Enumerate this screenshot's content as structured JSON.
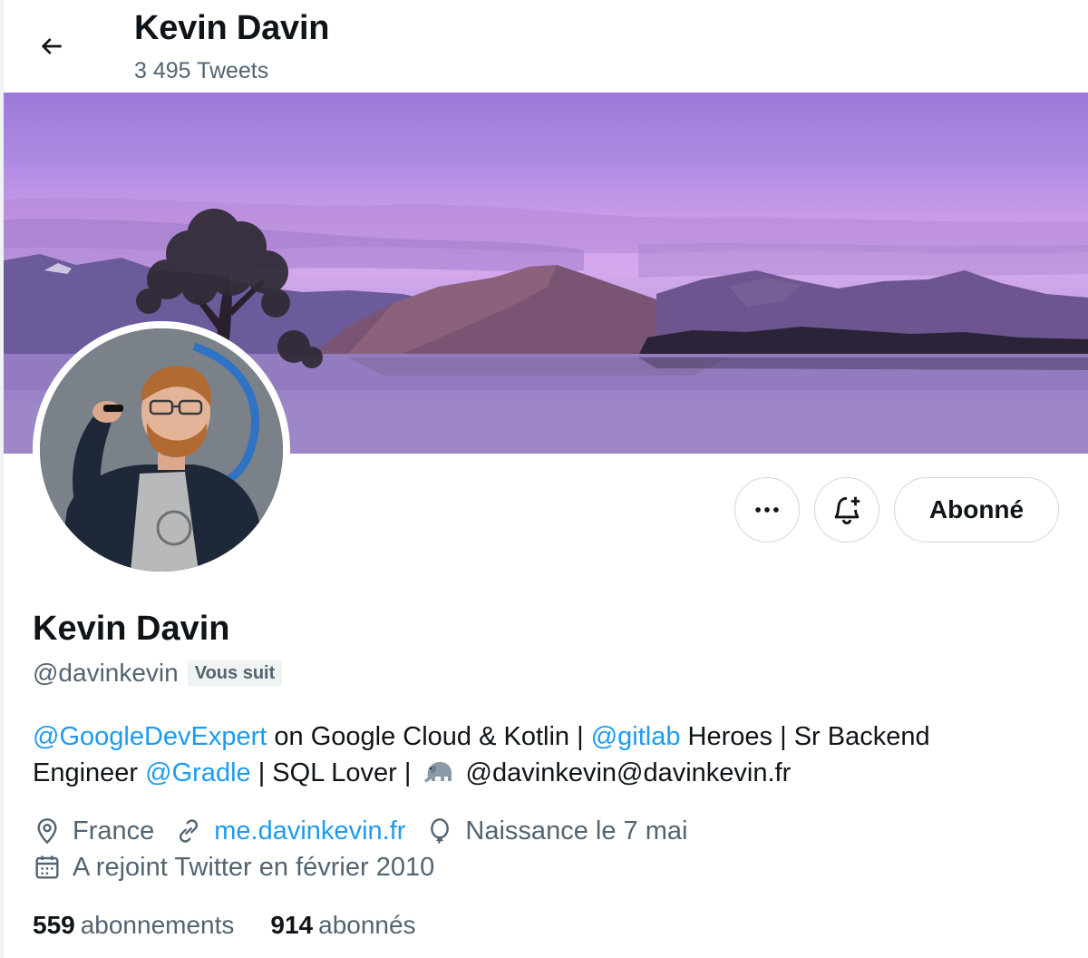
{
  "header": {
    "back_icon": "arrow-left-icon",
    "name": "Kevin Davin",
    "tweet_count": "3 495 Tweets"
  },
  "profile": {
    "display_name": "Kevin Davin",
    "handle": "@davinkevin",
    "follows_you_badge": "Vous suit",
    "follow_button_label": "Abonné",
    "more_icon": "more-horizontal-icon",
    "notify_icon": "bell-plus-icon"
  },
  "bio": {
    "mention_gde": "@GoogleDevExpert",
    "text_1": " on Google Cloud & Kotlin | ",
    "mention_gitlab": "@gitlab",
    "text_2": " Heroes | Sr Backend Engineer ",
    "mention_gradle": "@Gradle",
    "text_3": " | SQL Lover | ",
    "emoji_icon": "elephant-icon",
    "text_4": " @davinkevin@davinkevin.fr"
  },
  "meta": {
    "location_icon": "location-pin-icon",
    "location": "France",
    "link_icon": "link-icon",
    "website": "me.davinkevin.fr",
    "birthday_icon": "balloon-icon",
    "birthday": "Naissance le 7 mai",
    "joined_icon": "calendar-icon",
    "joined": "A rejoint Twitter en février 2010"
  },
  "stats": {
    "following_count": "559",
    "following_label": "abonnements",
    "followers_count": "914",
    "followers_label": "abonnés"
  },
  "colors": {
    "accent": "#1d9bf0",
    "secondary_text": "#536471",
    "primary_text": "#0f1419",
    "border": "#cfd9de"
  }
}
